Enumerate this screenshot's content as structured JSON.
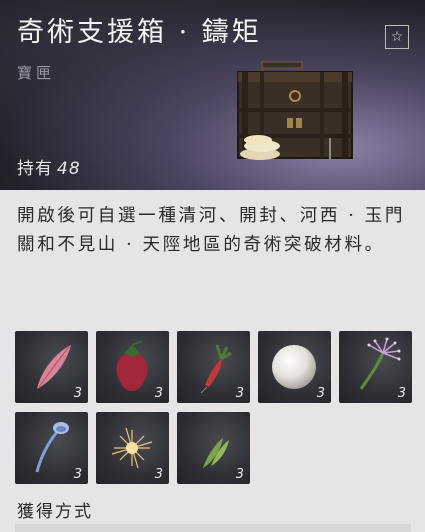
{
  "item": {
    "title": "奇術支援箱 · 鑄矩",
    "type": "寶匣",
    "holdings_label": "持有",
    "holdings_count": "48",
    "favorite_icon": "star-icon",
    "description": "開啟後可自選一種清河、開封、河西 · 玉門關和不見山 · 天陘地區的奇術突破材料。"
  },
  "materials": [
    {
      "icon": "pink-petal-icon",
      "qty": "3"
    },
    {
      "icon": "red-strawberry-icon",
      "qty": "3"
    },
    {
      "icon": "red-root-icon",
      "qty": "3"
    },
    {
      "icon": "white-pearl-icon",
      "qty": "3"
    },
    {
      "icon": "purple-grass-icon",
      "qty": "3"
    },
    {
      "icon": "blue-mushroom-icon",
      "qty": "3"
    },
    {
      "icon": "gold-dandelion-icon",
      "qty": "3"
    },
    {
      "icon": "green-leaf-icon",
      "qty": "3"
    }
  ],
  "obtain_heading": "獲得方式"
}
